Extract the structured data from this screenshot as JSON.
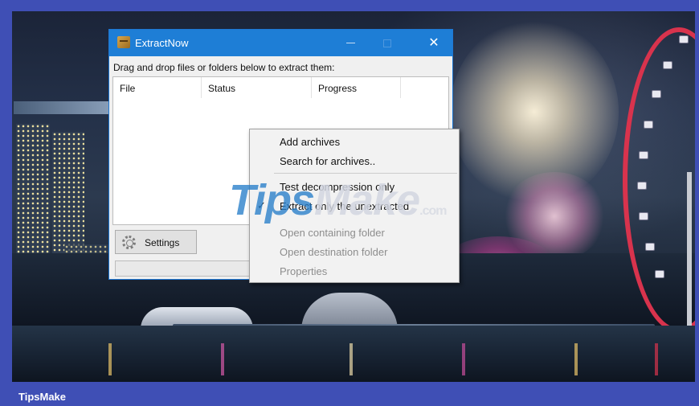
{
  "window": {
    "title": "ExtractNow",
    "minimize_glyph": "—",
    "close_glyph": "✕",
    "hint": "Drag and drop files or folders below to extract them:",
    "columns": [
      "File",
      "Status",
      "Progress"
    ],
    "settings_label": "Settings",
    "icons": {
      "app": "package-icon",
      "settings": "gear-icon"
    }
  },
  "context_menu": {
    "items": [
      {
        "label": "Add archives",
        "enabled": true,
        "checked": false
      },
      {
        "label": "Search for archives..",
        "enabled": true,
        "checked": false
      },
      {
        "label": "Test decompression only",
        "enabled": true,
        "checked": false
      },
      {
        "label": "Extract only the unextracted",
        "enabled": true,
        "checked": true
      },
      {
        "label": "Open containing folder",
        "enabled": false,
        "checked": false
      },
      {
        "label": "Open destination folder",
        "enabled": false,
        "checked": false
      },
      {
        "label": "Properties",
        "enabled": false,
        "checked": false
      }
    ],
    "check_glyph": "✓"
  },
  "watermark": {
    "part1": "Tips",
    "part2": "Make",
    "part3": ".com"
  },
  "footer": {
    "brand": "TipsMake"
  },
  "colors": {
    "frame": "#3f4fb5",
    "titlebar": "#1e7ed6",
    "menu_bg": "#f2f2f2",
    "watermark_blue": "#267ec9",
    "wheel_red": "#d8334d"
  }
}
